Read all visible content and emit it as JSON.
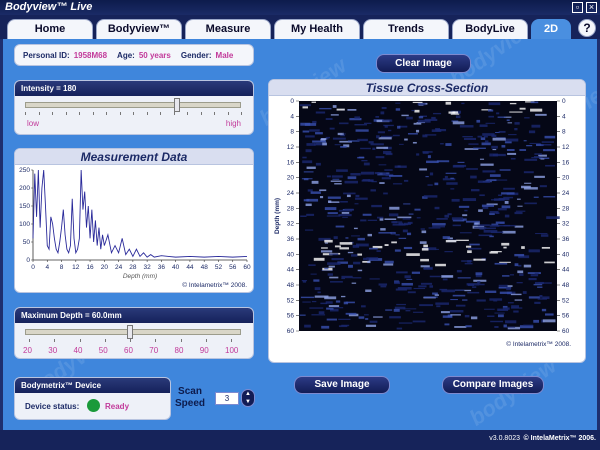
{
  "app": {
    "title": "Bodyview™ Live"
  },
  "tabs": [
    {
      "label": "Home"
    },
    {
      "label": "Bodyview™"
    },
    {
      "label": "Measure"
    },
    {
      "label": "My Health"
    },
    {
      "label": "Trends"
    },
    {
      "label": "BodyLive"
    },
    {
      "label": "2D"
    }
  ],
  "help_label": "?",
  "patient": {
    "id_label": "Personal ID:",
    "id_value": "1958M68",
    "age_label": "Age:",
    "age_value": "50 years",
    "gender_label": "Gender:",
    "gender_value": "Male"
  },
  "intensity": {
    "title": "Intensity = 180",
    "low_label": "low",
    "high_label": "high",
    "level": 180,
    "max": 255
  },
  "measurement": {
    "title": "Measurement Data",
    "copyright": "© Intelametrix™ 2008.",
    "chart_data": {
      "type": "line",
      "title": "Measurement Data",
      "xlabel": "Depth (mm)",
      "ylabel": "",
      "xlim": [
        0,
        60
      ],
      "ylim": [
        0,
        250
      ],
      "xticks": [
        0,
        4,
        8,
        12,
        16,
        20,
        24,
        28,
        32,
        36,
        40,
        44,
        48,
        52,
        56,
        60
      ],
      "yticks": [
        0,
        50,
        100,
        150,
        200,
        250
      ],
      "grid": false,
      "series": [
        {
          "color": "#2a2a9a",
          "x": [
            0,
            0.5,
            1,
            1.5,
            2,
            2.5,
            3,
            3.5,
            4,
            4.5,
            5,
            5.5,
            6,
            6.5,
            7,
            7.5,
            8,
            8.5,
            9,
            9.5,
            10,
            10.5,
            11,
            11.5,
            12,
            12.5,
            13,
            13.5,
            14,
            14.5,
            15,
            15.5,
            16,
            16.5,
            17,
            17.5,
            18,
            18.5,
            19,
            19.5,
            20,
            21,
            22,
            23,
            24,
            25,
            26,
            27,
            28,
            29,
            30,
            31,
            32,
            33,
            34,
            36,
            38,
            40,
            44,
            48,
            52,
            56,
            60
          ],
          "y": [
            60,
            240,
            120,
            250,
            90,
            200,
            250,
            150,
            40,
            30,
            120,
            100,
            60,
            30,
            20,
            50,
            90,
            140,
            70,
            30,
            20,
            40,
            170,
            60,
            20,
            30,
            60,
            250,
            140,
            190,
            90,
            150,
            60,
            140,
            50,
            110,
            40,
            90,
            30,
            70,
            40,
            70,
            20,
            40,
            20,
            60,
            15,
            30,
            10,
            30,
            10,
            20,
            8,
            15,
            8,
            12,
            10,
            8,
            10,
            8,
            10,
            8,
            10
          ]
        }
      ]
    }
  },
  "max_depth": {
    "title": "Maximum Depth = 60.0mm",
    "scale": [
      "20",
      "30",
      "40",
      "50",
      "60",
      "70",
      "80",
      "90",
      "100"
    ],
    "value": 60,
    "min": 20,
    "max": 100
  },
  "device": {
    "title": "Bodymetrix™ Device",
    "status_label": "Device status:",
    "status_value": "Ready",
    "status_color": "#1a9a3a"
  },
  "scan_speed": {
    "label_line1": "Scan",
    "label_line2": "Speed",
    "value": "3"
  },
  "tissue": {
    "title": "Tissue Cross-Section",
    "axis_label": "Depth (mm)",
    "ticks": [
      "0",
      "4",
      "8",
      "12",
      "16",
      "20",
      "24",
      "28",
      "32",
      "36",
      "40",
      "44",
      "48",
      "52",
      "56",
      "60"
    ],
    "copyright": "© Intelametrix™ 2008."
  },
  "buttons": {
    "clear_image": "Clear Image",
    "save_image": "Save Image",
    "compare_images": "Compare Images"
  },
  "footer": {
    "version": "v3.0.8023",
    "copyright": "© IntelaMetrix™ 2006."
  },
  "watermark": "bodyview"
}
